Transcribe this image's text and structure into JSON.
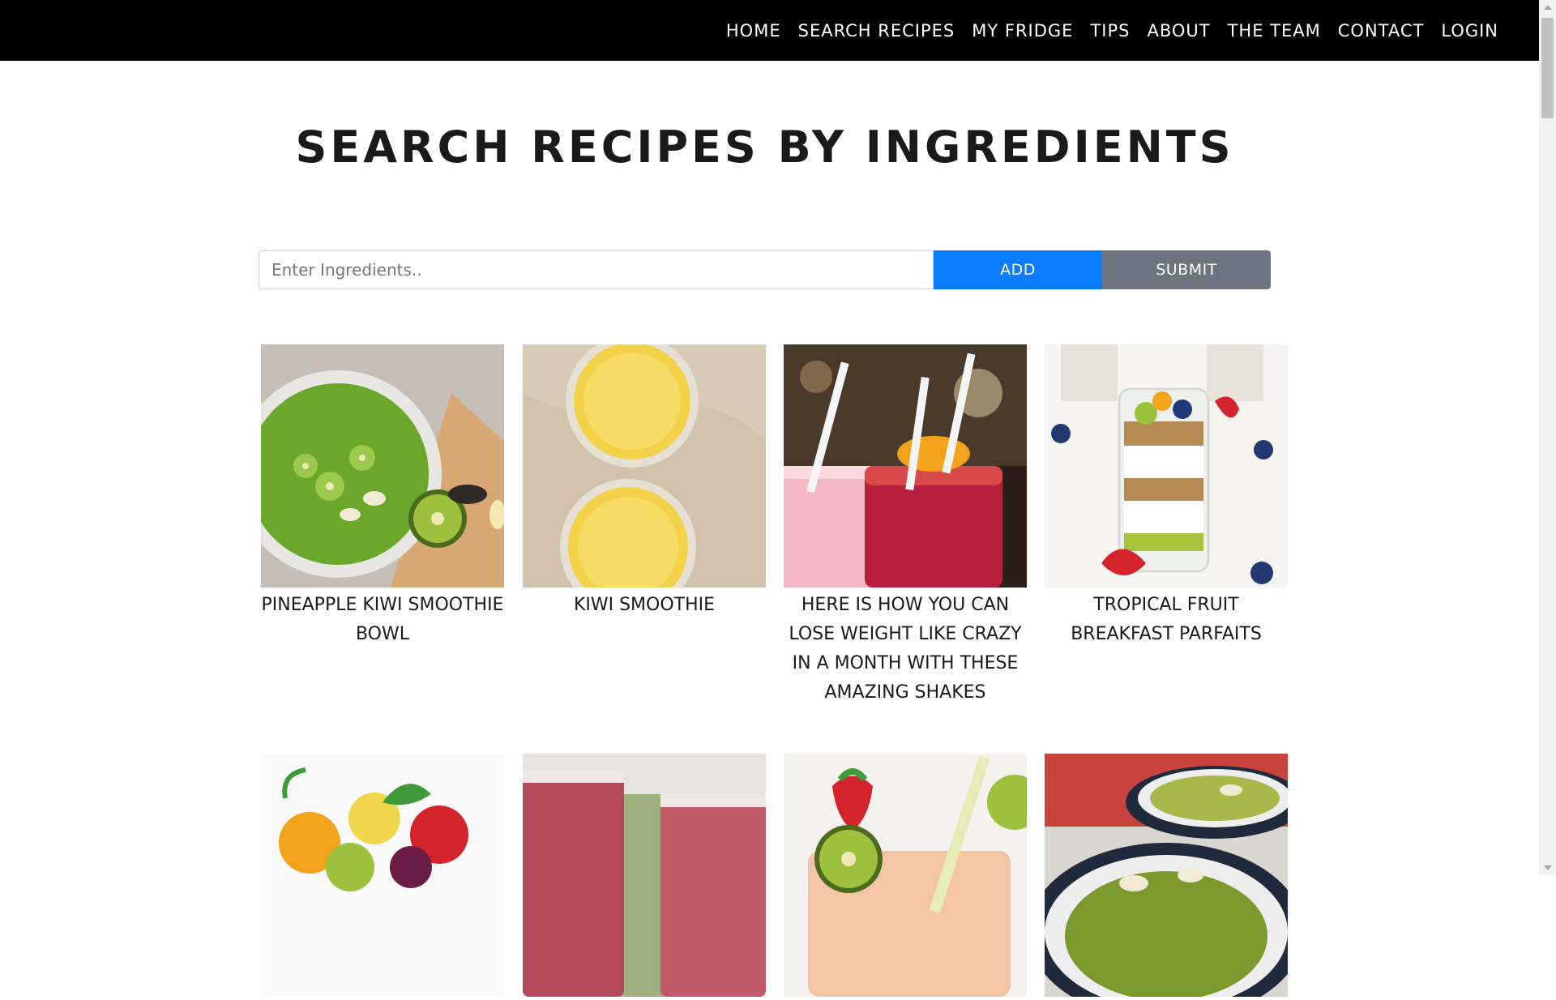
{
  "nav": {
    "items": [
      "HOME",
      "SEARCH RECIPES",
      "MY FRIDGE",
      "TIPS",
      "ABOUT",
      "THE TEAM",
      "CONTACT",
      "LOGIN"
    ]
  },
  "page": {
    "title": "SEARCH RECIPES BY INGREDIENTS"
  },
  "search": {
    "placeholder": "Enter Ingredients..",
    "value": "",
    "add_label": "ADD",
    "submit_label": "SUBMIT"
  },
  "recipes": [
    {
      "title": "PINEAPPLE KIWI SMOOTHIE BOWL"
    },
    {
      "title": "KIWI SMOOTHIE"
    },
    {
      "title": "HERE IS HOW YOU CAN LOSE WEIGHT LIKE CRAZY IN A MONTH WITH THESE AMAZING SHAKES"
    },
    {
      "title": "TROPICAL FRUIT BREAKFAST PARFAITS"
    },
    {
      "title": ""
    },
    {
      "title": ""
    },
    {
      "title": ""
    },
    {
      "title": ""
    }
  ],
  "colors": {
    "nav_bg": "#000000",
    "add_button": "#0a7cff",
    "submit_button": "#6c757d"
  }
}
